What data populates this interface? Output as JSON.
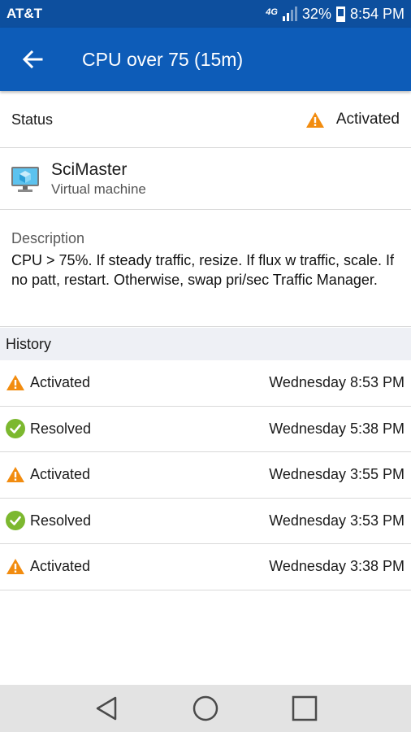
{
  "statusbar": {
    "carrier": "AT&T",
    "network": "4G",
    "battery_text": "32%",
    "battery_level": 0.32,
    "time": "8:54 PM"
  },
  "appbar": {
    "back_icon": "arrow-left-icon",
    "title": "CPU over 75 (15m)"
  },
  "status": {
    "label": "Status",
    "value": "Activated",
    "icon": "warning-icon"
  },
  "resource": {
    "name": "SciMaster",
    "type": "Virtual machine",
    "icon": "virtual-machine-icon"
  },
  "description": {
    "label": "Description",
    "text": "CPU > 75%. If steady traffic, resize. If flux w traffic, scale. If no patt, restart. Otherwise, swap pri/sec Traffic Manager."
  },
  "history": {
    "header": "History",
    "items": [
      {
        "state": "Activated",
        "icon": "warning-icon",
        "time": "Wednesday 8:53 PM"
      },
      {
        "state": "Resolved",
        "icon": "check-icon",
        "time": "Wednesday 5:38 PM"
      },
      {
        "state": "Activated",
        "icon": "warning-icon",
        "time": "Wednesday 3:55 PM"
      },
      {
        "state": "Resolved",
        "icon": "check-icon",
        "time": "Wednesday 3:53 PM"
      },
      {
        "state": "Activated",
        "icon": "warning-icon",
        "time": "Wednesday 3:38 PM"
      }
    ]
  },
  "colors": {
    "appbar": "#0d5cb8",
    "statusbar": "#0d4f9e",
    "warning": "#f28c0f",
    "resolved": "#7cb82f"
  }
}
